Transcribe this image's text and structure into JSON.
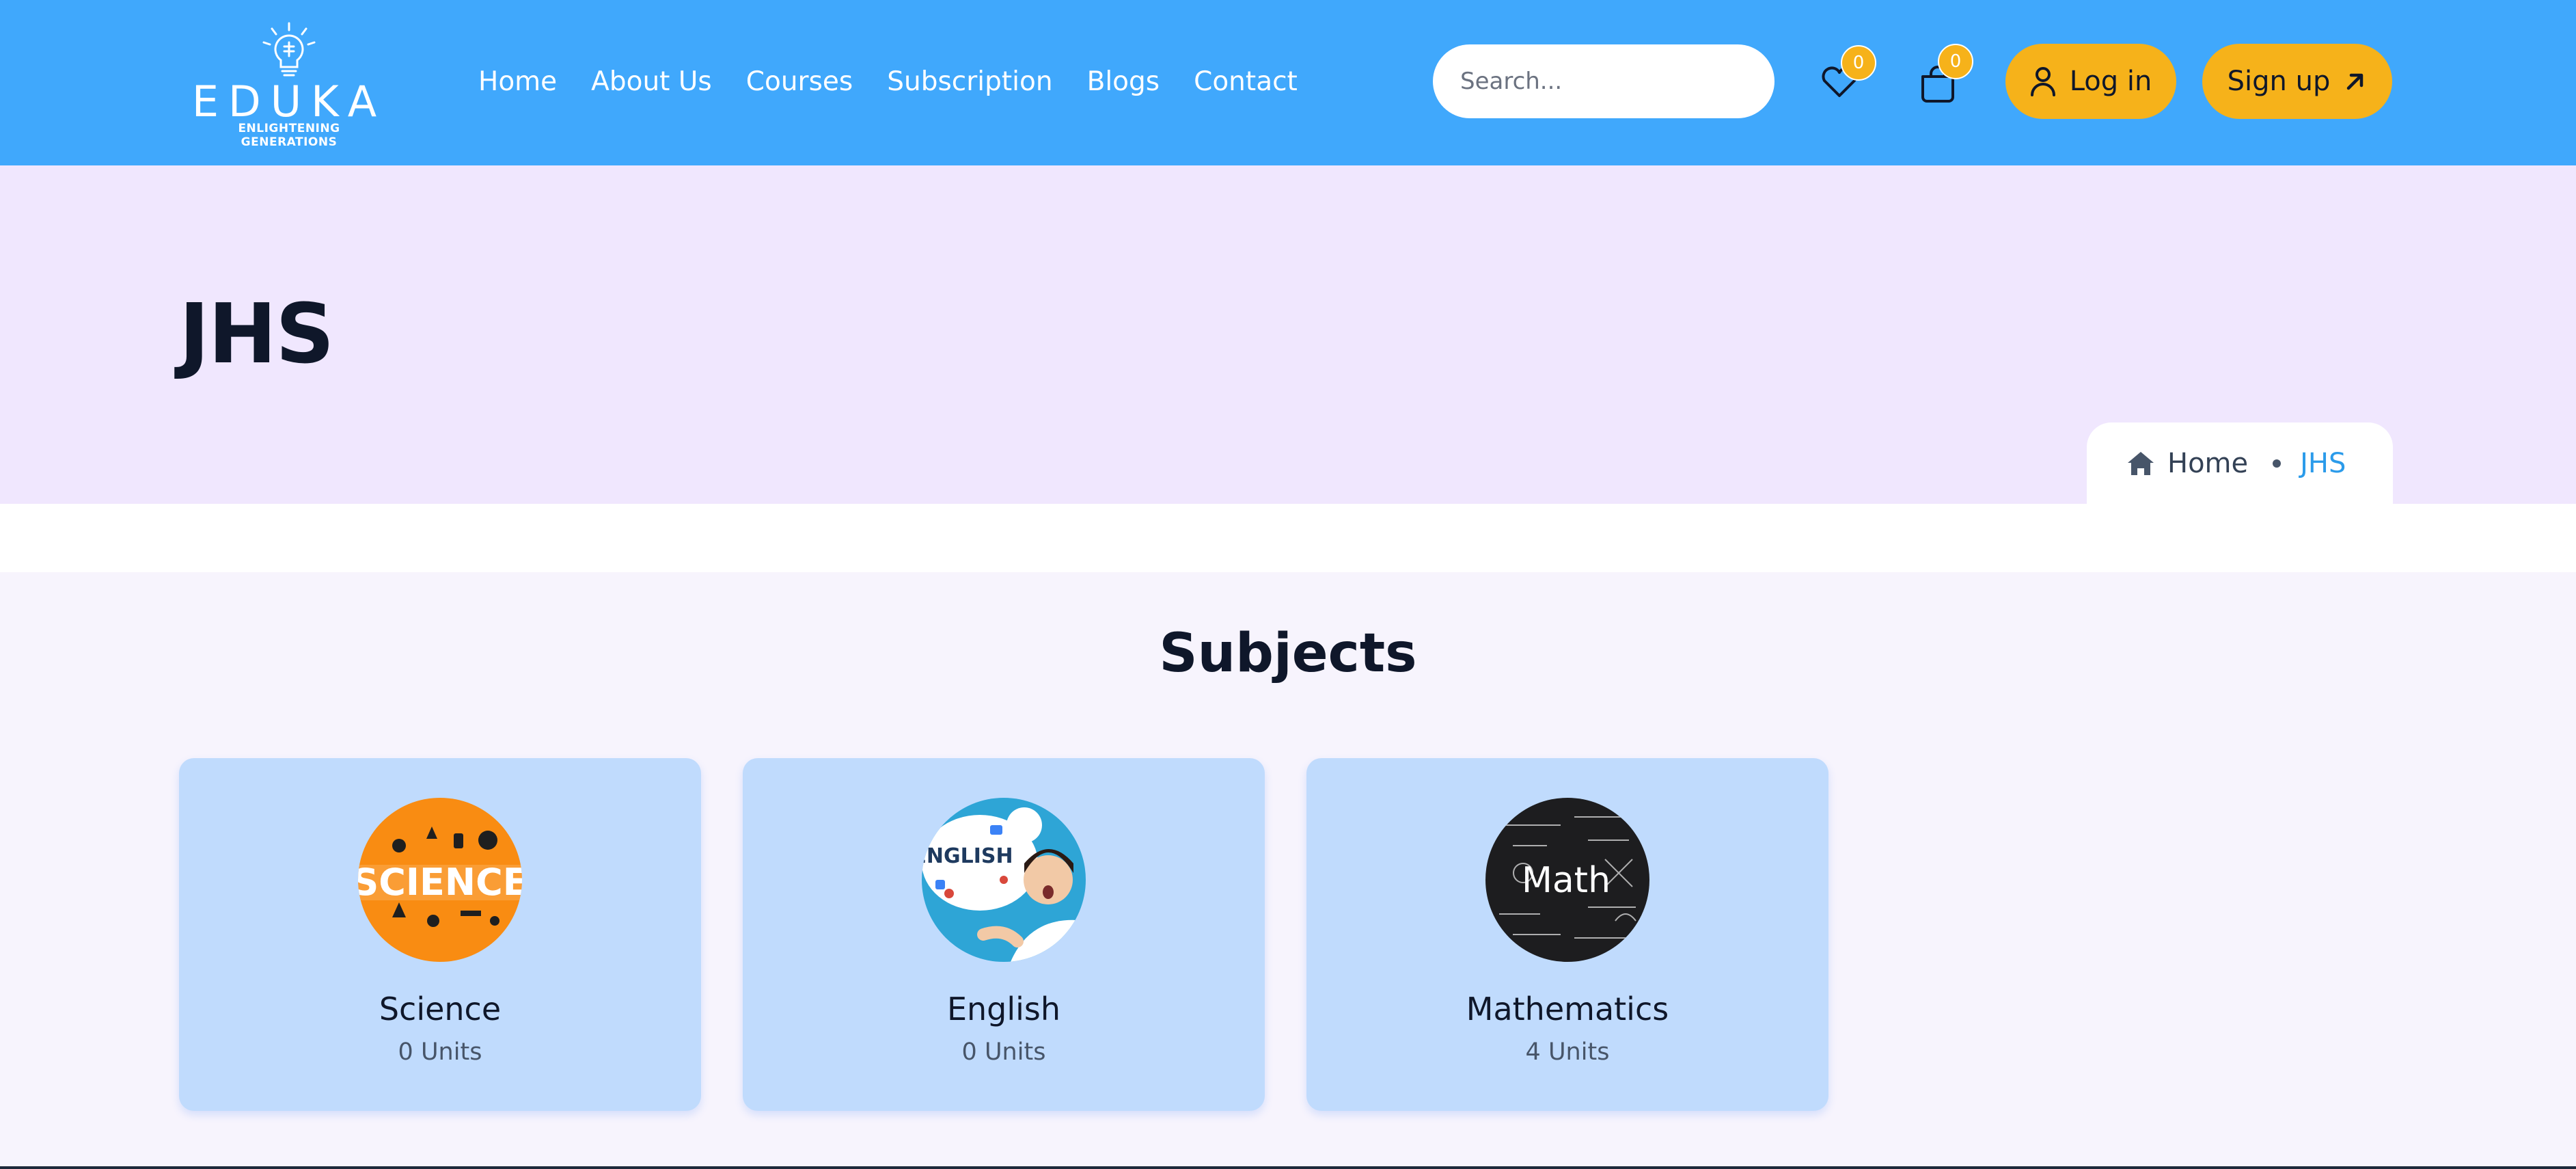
{
  "brand": {
    "name": "EDUKA",
    "tagline": "ENLIGHTENING GENERATIONS"
  },
  "nav": {
    "items": [
      "Home",
      "About Us",
      "Courses",
      "Subscription",
      "Blogs",
      "Contact"
    ]
  },
  "search": {
    "placeholder": "Search..."
  },
  "wishlist": {
    "icon": "heart-icon",
    "count": "0"
  },
  "cart": {
    "icon": "bag-icon",
    "count": "0"
  },
  "auth": {
    "login_label": "Log in",
    "signup_label": "Sign up"
  },
  "page": {
    "title": "JHS",
    "breadcrumb": {
      "home": "Home",
      "current": "JHS"
    }
  },
  "subjects": {
    "heading": "Subjects",
    "cards": [
      {
        "title": "Science",
        "units": "0 Units",
        "image": "science-thumbnail"
      },
      {
        "title": "English",
        "units": "0 Units",
        "image": "english-thumbnail"
      },
      {
        "title": "Mathematics",
        "units": "4 Units",
        "image": "math-thumbnail"
      }
    ]
  },
  "image_text": {
    "science": "SCIENCE",
    "english": "ENGLISH",
    "math": "Math"
  },
  "colors": {
    "header": "#40a8fc",
    "accent": "#f6b21a",
    "band": "#f0e7fe",
    "card": "#c0dbfd",
    "breadcrumb_active": "#2b9bea"
  }
}
